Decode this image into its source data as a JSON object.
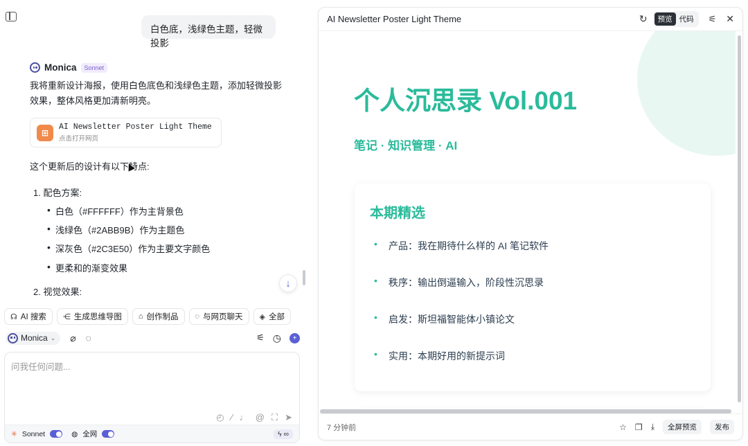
{
  "chat": {
    "user_message": "白色底，浅绿色主题，轻微投影",
    "bot_name": "Monica",
    "bot_badge": "Sonnet",
    "intro": "我将重新设计海报，使用白色底色和浅绿色主题，添加轻微投影效果，整体风格更加清新明亮。",
    "file_card": {
      "title": "AI Newsletter Poster Light Theme",
      "subtitle": "点击打开网页"
    },
    "features_heading": "这个更新后的设计有以下特点:",
    "list": [
      {
        "label": "1. 配色方案:",
        "bullets": [
          "白色（#FFFFFF）作为主背景色",
          "浅绿色（#2ABB9B）作为主题色",
          "深灰色（#2C3E50）作为主要文字颜色",
          "更柔和的渐变效果"
        ]
      },
      {
        "label": "2. 视觉效果:",
        "bullets": []
      }
    ]
  },
  "chips": [
    "AI 搜索",
    "生成思维导图",
    "创作制品",
    "与网页聊天",
    "全部"
  ],
  "model_selector": "Monica",
  "input": {
    "placeholder": "问我任何问题..."
  },
  "input_footer": {
    "model": "Sonnet",
    "web": "全网",
    "quota": "∞"
  },
  "preview": {
    "title": "AI Newsletter Poster Light Theme",
    "tab_preview": "预览",
    "tab_code": "代码",
    "poster_title": "个人沉思录 Vol.001",
    "poster_subtitle": "笔记 · 知识管理 · AI",
    "card_title": "本期精选",
    "card_items": [
      "产品：我在期待什么样的 AI 笔记软件",
      "秩序：输出倒逼输入，阶段性沉思录",
      "启发：斯坦福智能体小镇论文",
      "实用：本期好用的新提示词"
    ],
    "time": "7 分钟前",
    "fullscreen_label": "全屏预览",
    "publish_label": "发布"
  },
  "colors": {
    "accent": "#2ABB9B",
    "text": "#2C3E50",
    "brand": "#5B5FD6"
  }
}
